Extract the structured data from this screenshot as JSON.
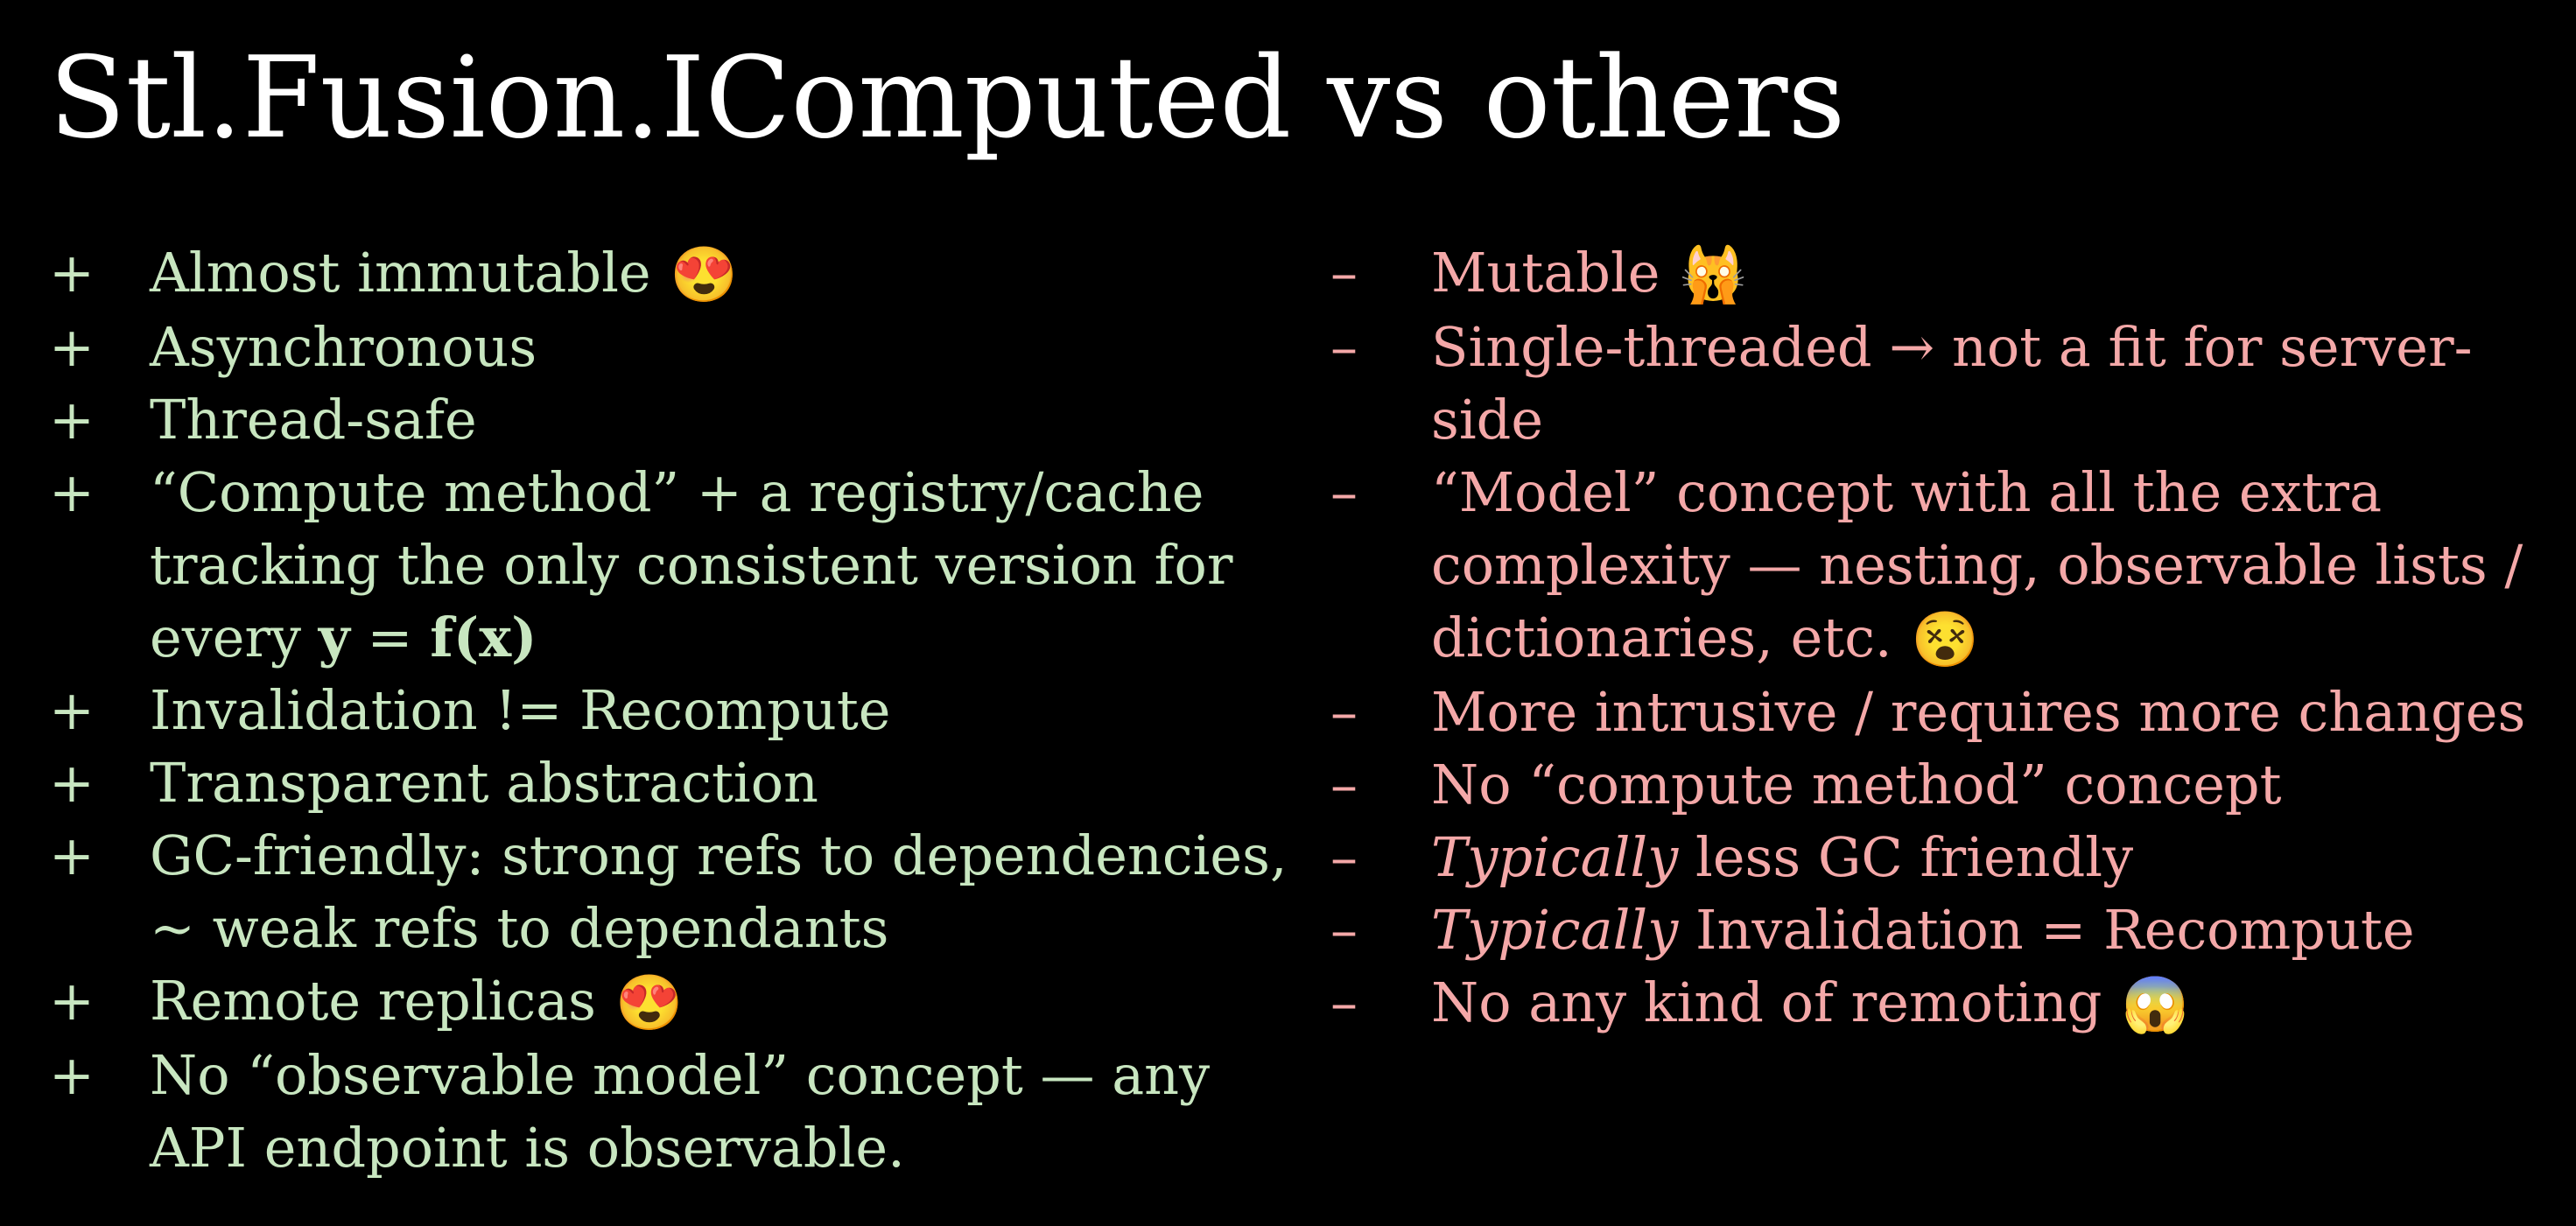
{
  "slide": {
    "title": "Stl.Fusion.IComputed vs others"
  },
  "pros": {
    "marker": "+",
    "items": [
      {
        "text": "Almost immutable",
        "emoji": "😍"
      },
      {
        "text": "Asynchronous"
      },
      {
        "text": "Thread-safe"
      },
      {
        "text_a": "“Compute method” + a registry/cache tracking the only consistent version for every ",
        "bold_a": "y",
        "text_b": " = ",
        "bold_b": "f(x)"
      },
      {
        "text": "Invalidation != Recompute"
      },
      {
        "text": "Transparent abstraction"
      },
      {
        "text": "GC-friendly: strong refs to dependencies, ~ weak refs to dependants"
      },
      {
        "text": "Remote replicas",
        "emoji": "😍"
      },
      {
        "text": "No “observable model” concept — any API endpoint is observable."
      }
    ]
  },
  "cons": {
    "marker": "–",
    "items": [
      {
        "text": "Mutable",
        "emoji": "🙀"
      },
      {
        "text": "Single-threaded → not a fit for server-side"
      },
      {
        "text": "“Model” concept with all the extra complexity — nesting, observable lists / dictionaries, etc.",
        "emoji": "😵"
      },
      {
        "text": "More intrusive / requires more changes"
      },
      {
        "text": "No “compute method” concept"
      },
      {
        "italic": "Typically",
        "text": " less GC friendly"
      },
      {
        "italic": "Typically",
        "text": " Invalidation = Recompute"
      },
      {
        "text": "No any kind of remoting",
        "emoji": "😱"
      }
    ]
  }
}
